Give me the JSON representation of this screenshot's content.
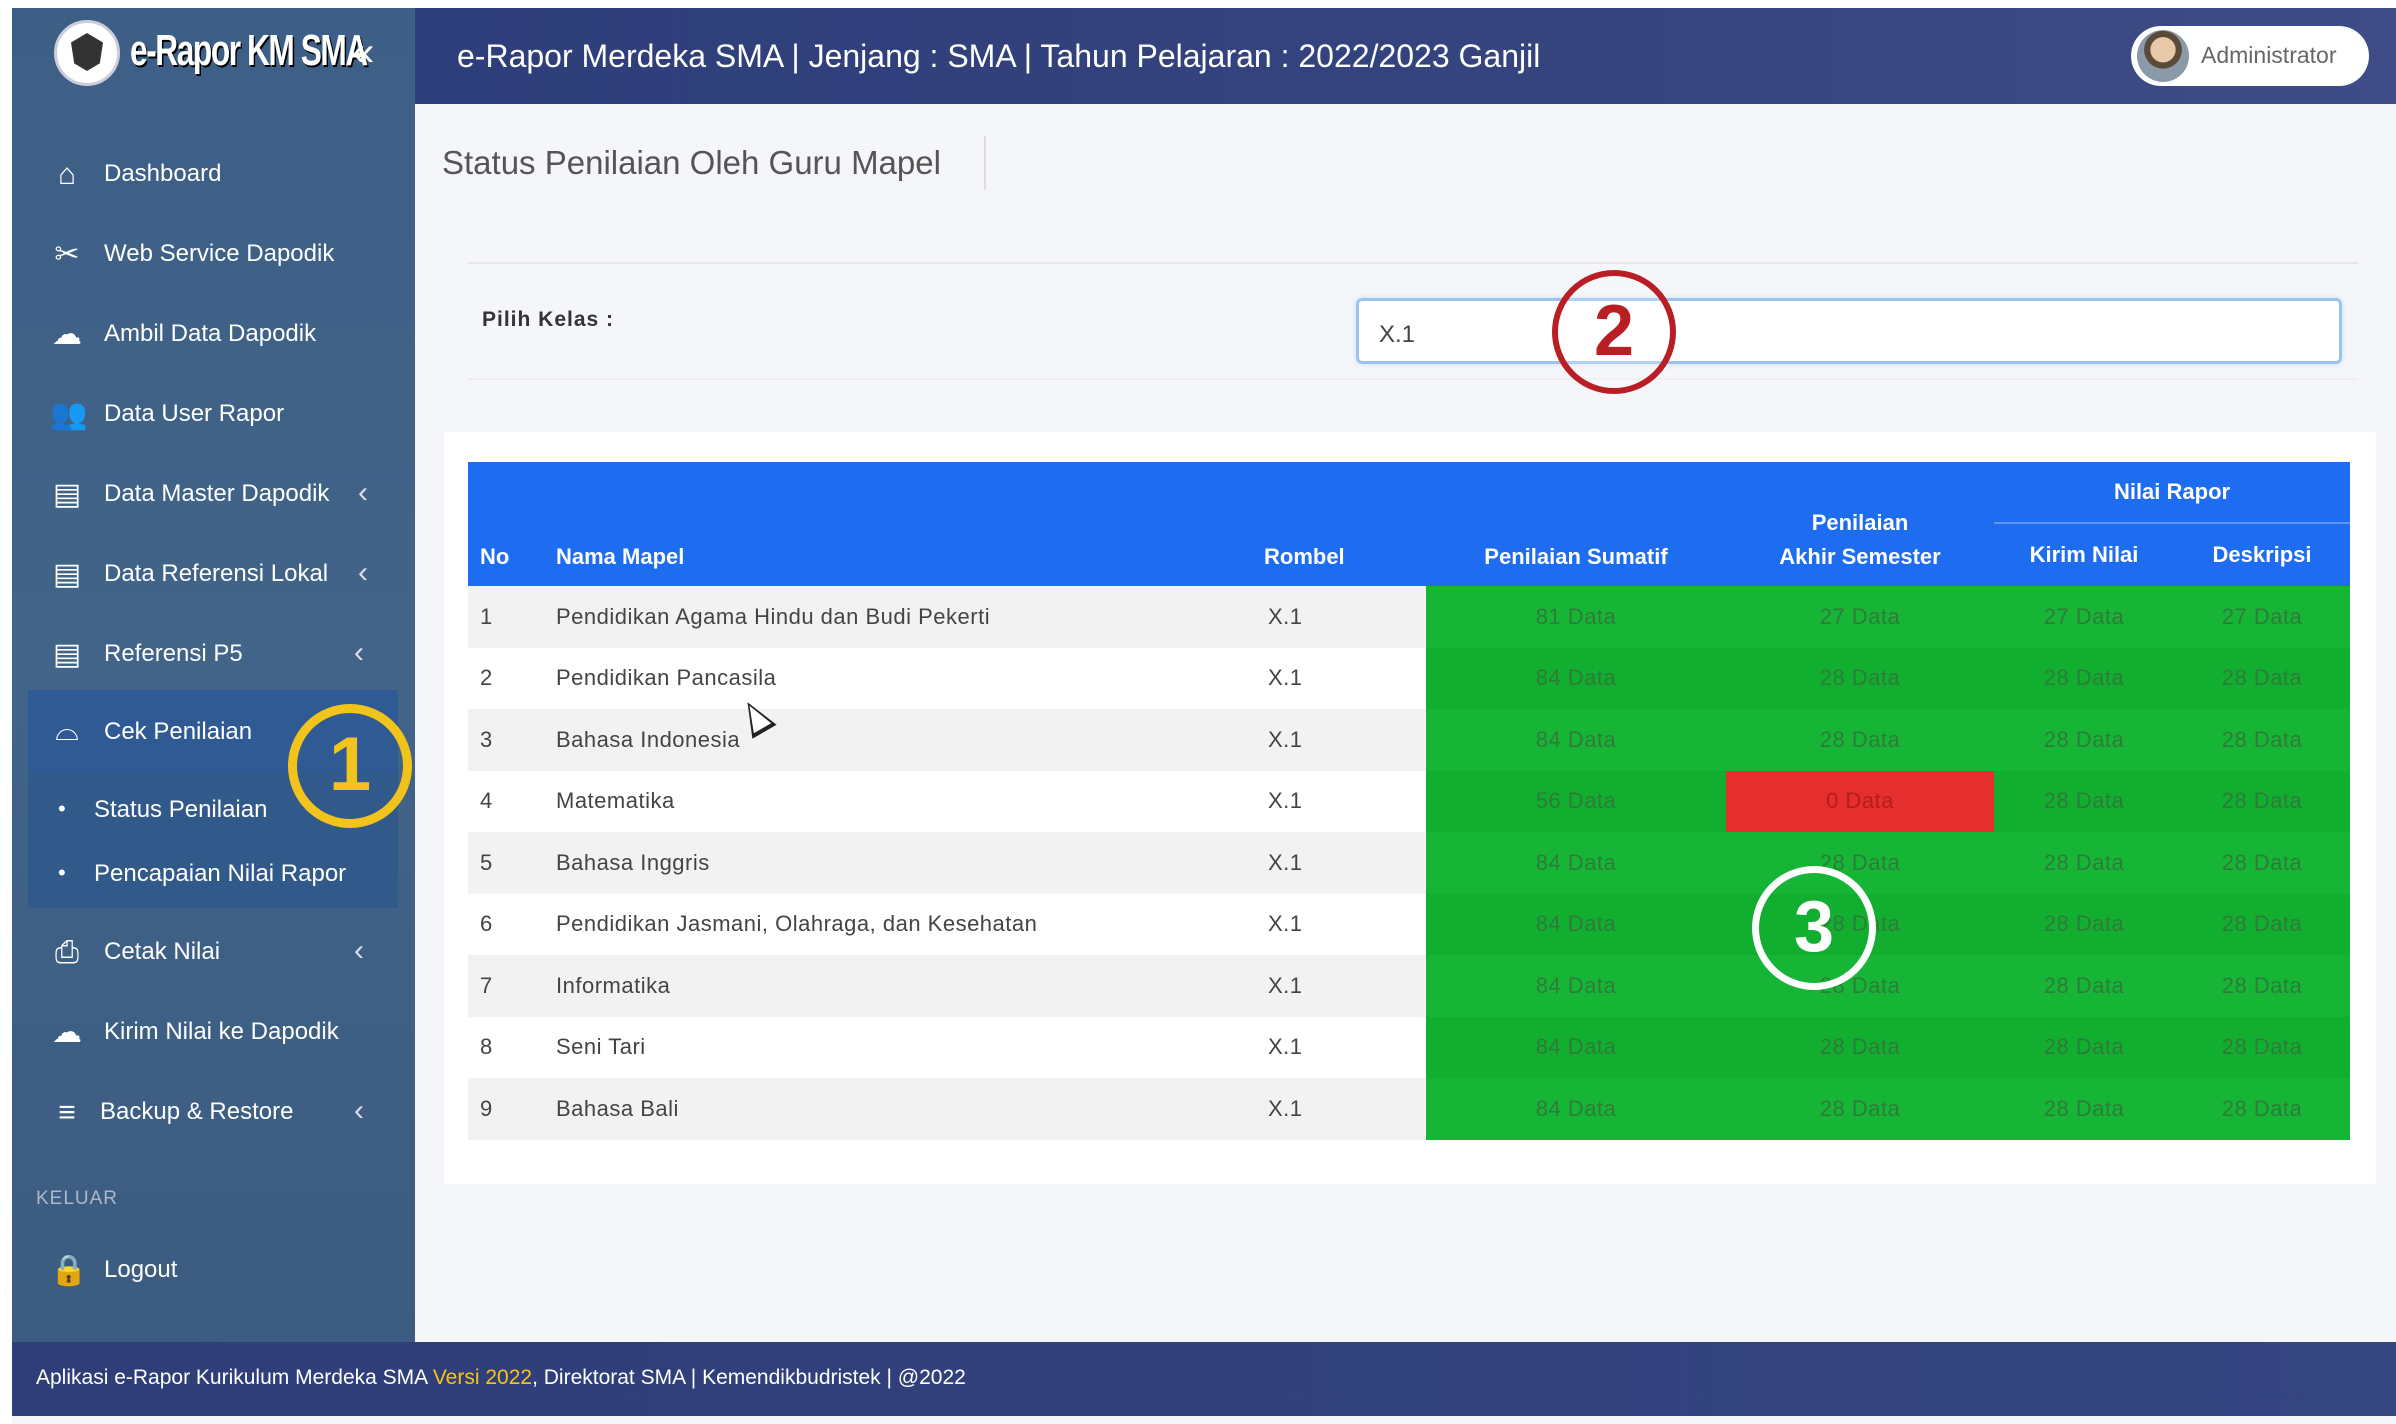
{
  "brand": {
    "name": "e-Rapor KM SMA",
    "collapse_icon": "«"
  },
  "topbar": {
    "title": "e-Rapor Merdeka SMA | Jenjang : SMA | Tahun Pelajaran : 2022/2023 Ganjil",
    "user": "Administrator"
  },
  "sidebar": {
    "items": [
      {
        "label": "Dashboard",
        "icon": "home-icon"
      },
      {
        "label": "Web Service Dapodik",
        "icon": "tools-icon"
      },
      {
        "label": "Ambil Data Dapodik",
        "icon": "cloud-download-icon"
      },
      {
        "label": "Data User Rapor",
        "icon": "users-icon"
      },
      {
        "label": "Data Master Dapodik",
        "icon": "archive-icon",
        "chevron": "‹"
      },
      {
        "label": "Data Referensi Lokal",
        "icon": "archive-icon",
        "chevron": "‹"
      },
      {
        "label": "Referensi P5",
        "icon": "archive-icon",
        "chevron": "‹"
      },
      {
        "label": "Cek Penilaian",
        "icon": "inbox-icon"
      },
      {
        "label": "Status Penilaian",
        "bullet": "•"
      },
      {
        "label": "Pencapaian Nilai Rapor",
        "bullet": "•"
      },
      {
        "label": "Cetak Nilai",
        "icon": "print-icon",
        "chevron": "‹"
      },
      {
        "label": "Kirim Nilai ke Dapodik",
        "icon": "cloud-upload-icon"
      },
      {
        "label": "Backup & Restore",
        "icon": "database-icon",
        "chevron": "‹"
      }
    ],
    "section_label": "KELUAR",
    "logout": {
      "label": "Logout",
      "icon": "lock-icon"
    }
  },
  "main": {
    "title": "Status Penilaian Oleh Guru Mapel",
    "pilih_kelas_label": "Pilih Kelas :",
    "kelas_value": "X.1",
    "table": {
      "headers": {
        "no": "No",
        "nama_mapel": "Nama Mapel",
        "rombel": "Rombel",
        "sumatif": "Penilaian Sumatif",
        "pas_line1": "Penilaian",
        "pas_line2": "Akhir Semester",
        "nilai_rapor": "Nilai Rapor",
        "kirim_nilai": "Kirim Nilai",
        "deskripsi": "Deskripsi"
      },
      "rows": [
        {
          "no": "1",
          "mapel": "Pendidikan Agama Hindu dan Budi Pekerti",
          "rombel": "X.1",
          "sumatif": "81 Data",
          "pas": "27 Data",
          "kirim": "27 Data",
          "deskripsi": "27 Data"
        },
        {
          "no": "2",
          "mapel": "Pendidikan Pancasila",
          "rombel": "X.1",
          "sumatif": "84 Data",
          "pas": "28 Data",
          "kirim": "28 Data",
          "deskripsi": "28 Data"
        },
        {
          "no": "3",
          "mapel": "Bahasa Indonesia",
          "rombel": "X.1",
          "sumatif": "84 Data",
          "pas": "28 Data",
          "kirim": "28 Data",
          "deskripsi": "28 Data"
        },
        {
          "no": "4",
          "mapel": "Matematika",
          "rombel": "X.1",
          "sumatif": "56 Data",
          "pas": "0 Data",
          "kirim": "28 Data",
          "deskripsi": "28 Data"
        },
        {
          "no": "5",
          "mapel": "Bahasa Inggris",
          "rombel": "X.1",
          "sumatif": "84 Data",
          "pas": "28 Data",
          "kirim": "28 Data",
          "deskripsi": "28 Data"
        },
        {
          "no": "6",
          "mapel": "Pendidikan Jasmani, Olahraga, dan Kesehatan",
          "rombel": "X.1",
          "sumatif": "84 Data",
          "pas": "28 Data",
          "kirim": "28 Data",
          "deskripsi": "28 Data"
        },
        {
          "no": "7",
          "mapel": "Informatika",
          "rombel": "X.1",
          "sumatif": "84 Data",
          "pas": "28 Data",
          "kirim": "28 Data",
          "deskripsi": "28 Data"
        },
        {
          "no": "8",
          "mapel": "Seni Tari",
          "rombel": "X.1",
          "sumatif": "84 Data",
          "pas": "28 Data",
          "kirim": "28 Data",
          "deskripsi": "28 Data"
        },
        {
          "no": "9",
          "mapel": "Bahasa Bali",
          "rombel": "X.1",
          "sumatif": "84 Data",
          "pas": "28 Data",
          "kirim": "28 Data",
          "deskripsi": "28 Data"
        }
      ]
    }
  },
  "annotations": {
    "one": "1",
    "two": "2",
    "three": "3"
  },
  "footer": {
    "prefix": "Aplikasi e-Rapor Kurikulum Merdeka SMA ",
    "versi": "Versi 2022",
    "suffix": ", Direktorat SMA | Kemendikbudristek | @2022"
  },
  "colors": {
    "topbar": "#36447e",
    "sidebar": "#426488",
    "table_header": "#1e6cf0",
    "status_ok": "#13b233",
    "status_missing": "#e52f2f",
    "badge_1": "#f2c41b",
    "badge_2": "#b91e24"
  }
}
